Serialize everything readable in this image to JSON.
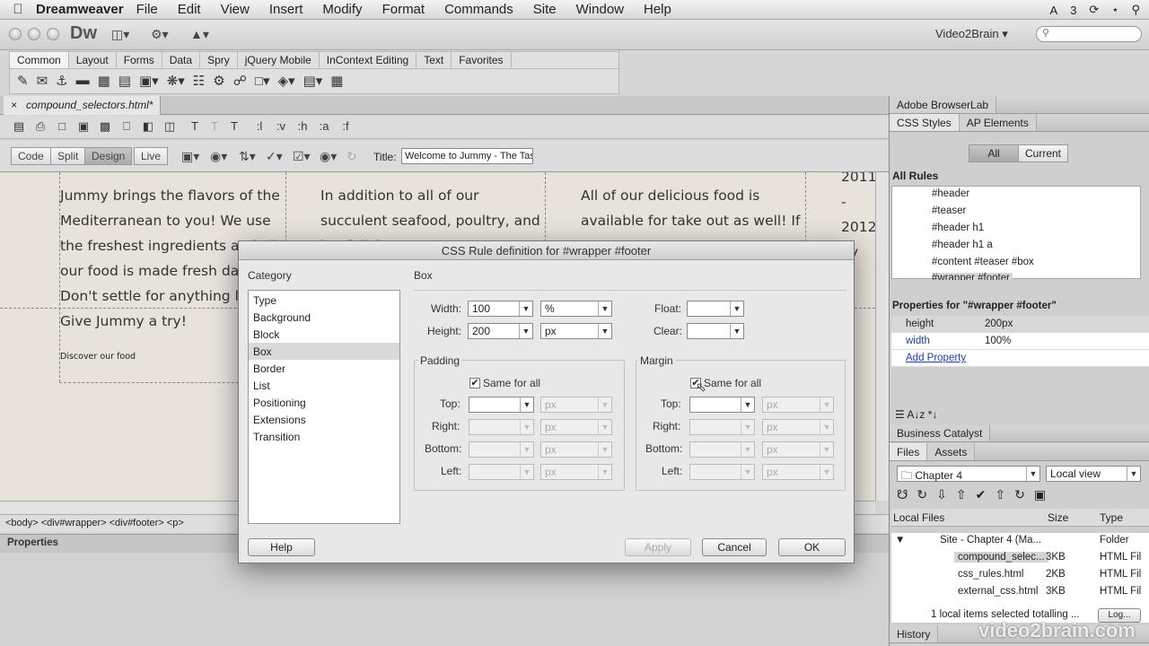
{
  "menubar": {
    "app_name": "Dreamweaver",
    "items": [
      "File",
      "Edit",
      "View",
      "Insert",
      "Modify",
      "Format",
      "Commands",
      "Site",
      "Window",
      "Help"
    ],
    "status_badge": "3"
  },
  "appbar": {
    "logo": "Dw",
    "workspace": "Video2Brain"
  },
  "insert_bar": {
    "tabs": [
      "Common",
      "Layout",
      "Forms",
      "Data",
      "Spry",
      "jQuery Mobile",
      "InContext Editing",
      "Text",
      "Favorites"
    ]
  },
  "document": {
    "tab_label": "compound_selectors.html*",
    "close_glyph": "×",
    "view_buttons": [
      "Code",
      "Split",
      "Design",
      "Live"
    ],
    "title_label": "Title:",
    "title_value": "Welcome to Jummy - The Tas",
    "format_buttons": [
      ":l",
      ":v",
      ":h",
      ":a",
      ":f"
    ],
    "col1": "Jummy brings the flavors of the Mediterranean to you! We use the freshest ingredients and all our food is made fresh daily. Don't settle for anything less! Give Jummy a try!",
    "col1_link": "Discover our food",
    "col2": "In addition to all of our succulent seafood, poultry, and beef dishes,",
    "col3": "All of our delicious food is available for take out as well! If",
    "col4": "2011 - 2012 by",
    "tag_selector": "<body> <div#wrapper> <div#footer> <p>",
    "properties_title": "Properties"
  },
  "right_panel": {
    "browserlab": "Adobe BrowserLab",
    "css_tabs": [
      "CSS Styles",
      "AP Elements"
    ],
    "view_modes": [
      "All",
      "Current"
    ],
    "all_rules_label": "All Rules",
    "rules": [
      "#header",
      "#teaser",
      "#header h1",
      "#header h1 a",
      "#content #teaser #box",
      "#wrapper #footer"
    ],
    "properties_for": "Properties for \"#wrapper #footer\"",
    "props": [
      {
        "key": "height",
        "value": "200px"
      },
      {
        "key": "width",
        "value": "100%"
      }
    ],
    "add_property": "Add Property",
    "business_catalyst": "Business Catalyst",
    "files_tabs": [
      "Files",
      "Assets"
    ],
    "site_select": "Chapter 4",
    "view_select": "Local view",
    "files_headers": [
      "Local Files",
      "Size",
      "Type"
    ],
    "files": [
      {
        "name": "Site - Chapter 4 (Ma...",
        "size": "",
        "type": "Folder"
      },
      {
        "name": "compound_selec...",
        "size": "3KB",
        "type": "HTML Fil"
      },
      {
        "name": "css_rules.html",
        "size": "2KB",
        "type": "HTML Fil"
      },
      {
        "name": "external_css.html",
        "size": "3KB",
        "type": "HTML Fil"
      }
    ],
    "status": "1 local items selected totalling ...",
    "log_button": "Log...",
    "history": "History"
  },
  "dialog": {
    "title": "CSS Rule definition for #wrapper #footer",
    "category_label": "Category",
    "categories": [
      "Type",
      "Background",
      "Block",
      "Box",
      "Border",
      "List",
      "Positioning",
      "Extensions",
      "Transition"
    ],
    "selected_category": "Box",
    "section": "Box",
    "width_label": "Width:",
    "width_value": "100",
    "width_unit": "%",
    "height_label": "Height:",
    "height_value": "200",
    "height_unit": "px",
    "float_label": "Float:",
    "clear_label": "Clear:",
    "padding_label": "Padding",
    "margin_label": "Margin",
    "same_for_all": "Same for all",
    "check": "✔",
    "side_labels": [
      "Top:",
      "Right:",
      "Bottom:",
      "Left:"
    ],
    "unit_px": "px",
    "help": "Help",
    "apply": "Apply",
    "cancel": "Cancel",
    "ok": "OK"
  },
  "watermark": "video2brain.com",
  "colors": {
    "accent": "#5a7bb5",
    "link": "#1a3fa8"
  }
}
